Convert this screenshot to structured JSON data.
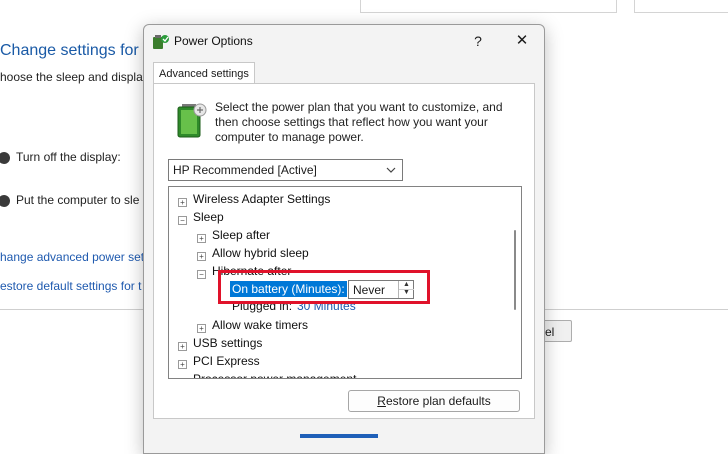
{
  "background": {
    "title": "Change settings for th",
    "subtitle": "hoose the sleep and displa",
    "row_display": "Turn off the display:",
    "row_sleep": "Put the computer to sle",
    "link_advanced": "hange advanced power set",
    "link_restore": "estore default settings for t",
    "button_partial": "el"
  },
  "dialog": {
    "title": "Power Options",
    "help_glyph": "?",
    "close_glyph": "✕",
    "tab_label": "Advanced settings",
    "description": "Select the power plan that you want to customize, and then choose settings that reflect how you want your computer to manage power.",
    "plan_select": {
      "value": "HP Recommended [Active]"
    },
    "tree": [
      {
        "label": "Wireless Adapter Settings",
        "expander": "+"
      },
      {
        "label": "Sleep",
        "expander": "−"
      },
      {
        "label": "Sleep after",
        "expander": "+"
      },
      {
        "label": "Allow hybrid sleep",
        "expander": "+"
      },
      {
        "label": "Hibernate after",
        "expander": "−"
      },
      {
        "label": "Allow wake timers",
        "expander": "+"
      },
      {
        "label": "USB settings",
        "expander": "+"
      },
      {
        "label": "PCI Express",
        "expander": "+"
      },
      {
        "label": "Processor power management",
        "expander": "+"
      }
    ],
    "on_battery": {
      "label": "On battery (Minutes):",
      "value": "Never"
    },
    "plugged_in": {
      "label": "Plugged in:",
      "value": "30 Minutes"
    },
    "restore_button": {
      "label": "Restore plan defaults",
      "accel": "R",
      "rest": "estore plan defaults"
    }
  },
  "colors": {
    "accent": "#0078d7",
    "link": "#1f5aaf",
    "highlight_box": "#e0122a"
  },
  "icons": {
    "app": "power-options-icon",
    "battery": "battery-plan-icon",
    "dropdown": "chevron-down-icon"
  }
}
